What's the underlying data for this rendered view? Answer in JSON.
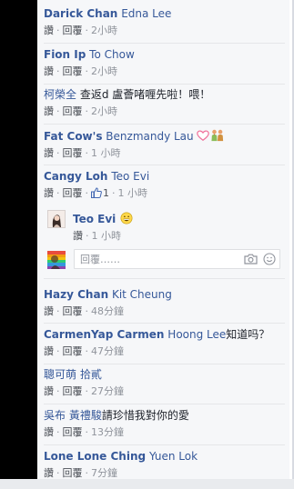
{
  "actions": {
    "like": "讚",
    "reply": "回覆",
    "separator": "·"
  },
  "comments": [
    {
      "name": "Darick Chan",
      "tag": "Edna Lee",
      "text": "",
      "time": "2小時"
    },
    {
      "name": "Fion Ip",
      "tag": "To Chow",
      "text": "",
      "time": "2小時"
    },
    {
      "name": "柯榮全",
      "tag": "",
      "text": "查返d 盧薈啫喱先啦！喂！",
      "time": "2小時"
    },
    {
      "name": "Fat Cow's",
      "tag": "Benzmandy Lau",
      "text": "",
      "time": "1 小時",
      "emoji": [
        "heart-icon",
        "couple-icon"
      ]
    },
    {
      "name": "Cangy Loh",
      "tag": "Teo Evi",
      "text": "",
      "time": "1 小時",
      "likes": "1"
    },
    {
      "name": "Hazy Chan",
      "tag": "Kit Cheung",
      "text": "",
      "time": "48分鐘"
    },
    {
      "name": "CarmenYap Carmen",
      "tag": "Hoong Lee",
      "text": "知道吗？",
      "time": "47分鐘"
    },
    {
      "name": "聰可萌",
      "tag": "拾貳",
      "text": "",
      "time": "27分鐘"
    },
    {
      "name": "吳布",
      "tag": "黃禮駿",
      "text": "請珍惜我對你的愛",
      "time": "13分鐘"
    },
    {
      "name": "Lone Lone Ching",
      "tag": "Yuen Lok",
      "text": "",
      "time": "7分鐘"
    }
  ],
  "reply": {
    "name": "Teo Evi",
    "emoji": "grinning-face-icon",
    "time": "1 小時"
  },
  "composer": {
    "placeholder": "回覆……",
    "icons": [
      "camera-icon",
      "emoji-icon"
    ]
  },
  "colors": {
    "name": "#365899",
    "meta": "#90949c",
    "panel": "#f6f7f9",
    "divider": "#e5e6e9",
    "heart": "#f0709a"
  }
}
